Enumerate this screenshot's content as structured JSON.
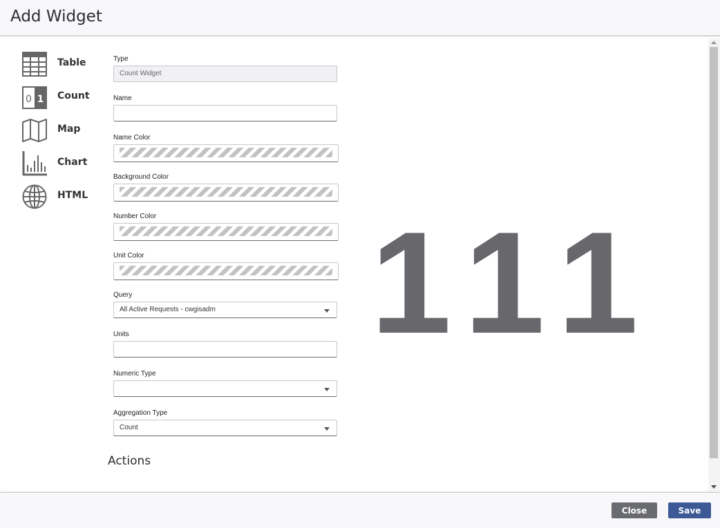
{
  "dialog": {
    "title": "Add Widget"
  },
  "sidebar": {
    "items": [
      {
        "label": "Table",
        "icon": "table-icon"
      },
      {
        "label": "Count",
        "icon": "count-icon"
      },
      {
        "label": "Map",
        "icon": "map-icon"
      },
      {
        "label": "Chart",
        "icon": "chart-icon"
      },
      {
        "label": "HTML",
        "icon": "globe-icon"
      }
    ]
  },
  "form": {
    "type": {
      "label": "Type",
      "value": "Count Widget"
    },
    "name": {
      "label": "Name",
      "value": ""
    },
    "name_color": {
      "label": "Name Color"
    },
    "background_color": {
      "label": "Background Color"
    },
    "number_color": {
      "label": "Number Color"
    },
    "unit_color": {
      "label": "Unit Color"
    },
    "query": {
      "label": "Query",
      "value": "All Active Requests - cwgisadm"
    },
    "units": {
      "label": "Units",
      "value": ""
    },
    "numeric_type": {
      "label": "Numeric Type",
      "value": ""
    },
    "aggregation_type": {
      "label": "Aggregation Type",
      "value": "Count"
    }
  },
  "actions": {
    "title": "Actions"
  },
  "preview": {
    "value": "111",
    "color": "#67676c"
  },
  "footer": {
    "close_label": "Close",
    "save_label": "Save"
  },
  "colors": {
    "close_button": "#6a6b70",
    "save_button": "#3d5a96"
  }
}
